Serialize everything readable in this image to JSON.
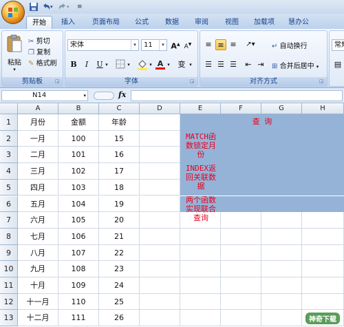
{
  "tabs": [
    "开始",
    "插入",
    "页面布局",
    "公式",
    "数据",
    "审阅",
    "视图",
    "加载项",
    "慧办公"
  ],
  "ribbon": {
    "clipboard": {
      "paste": "粘贴",
      "cut": "剪切",
      "copy": "复制",
      "format_painter": "格式刷",
      "label": "剪贴板"
    },
    "font": {
      "name": "宋体",
      "size": "11",
      "label": "字体",
      "bold": "B",
      "italic": "I",
      "underline": "U",
      "grow": "A",
      "shrink": "A",
      "font_color_glyph": "A",
      "phonetic_glyph": "变"
    },
    "alignment": {
      "wrap": "自动换行",
      "merge": "合并后居中",
      "label": "对齐方式"
    },
    "number": {
      "format": "常规"
    }
  },
  "formula_bar": {
    "name_box": "N14",
    "fx": "fx",
    "value": ""
  },
  "columns": [
    "A",
    "B",
    "C",
    "D",
    "E",
    "F",
    "G",
    "H"
  ],
  "rows": [
    "1",
    "2",
    "3",
    "4",
    "5",
    "6",
    "7",
    "8",
    "9",
    "10",
    "11",
    "12",
    "13"
  ],
  "table": {
    "headers": [
      "月份",
      "金额",
      "年龄"
    ],
    "data": [
      [
        "一月",
        "100",
        "15"
      ],
      [
        "二月",
        "101",
        "16"
      ],
      [
        "三月",
        "102",
        "17"
      ],
      [
        "四月",
        "103",
        "18"
      ],
      [
        "五月",
        "104",
        "19"
      ],
      [
        "六月",
        "105",
        "20"
      ],
      [
        "七月",
        "106",
        "21"
      ],
      [
        "八月",
        "107",
        "22"
      ],
      [
        "九月",
        "108",
        "23"
      ],
      [
        "十月",
        "109",
        "24"
      ],
      [
        "十一月",
        "110",
        "25"
      ],
      [
        "十二月",
        "111",
        "26"
      ]
    ]
  },
  "query_box": {
    "title": "查 询",
    "notes": [
      "MATCH函数锁定月份",
      "INDEX返回关联数据",
      "两个函数实现联合查询"
    ],
    "note_lines": [
      [
        "MATCH函",
        "数锁定月",
        "份"
      ],
      [
        "INDEX返",
        "回关联数",
        "据"
      ],
      [
        "两个函数",
        "实现联合",
        "查询"
      ]
    ],
    "fill": "#95b3d7",
    "text_color": "#e8001c"
  },
  "watermark": "神奇下载"
}
